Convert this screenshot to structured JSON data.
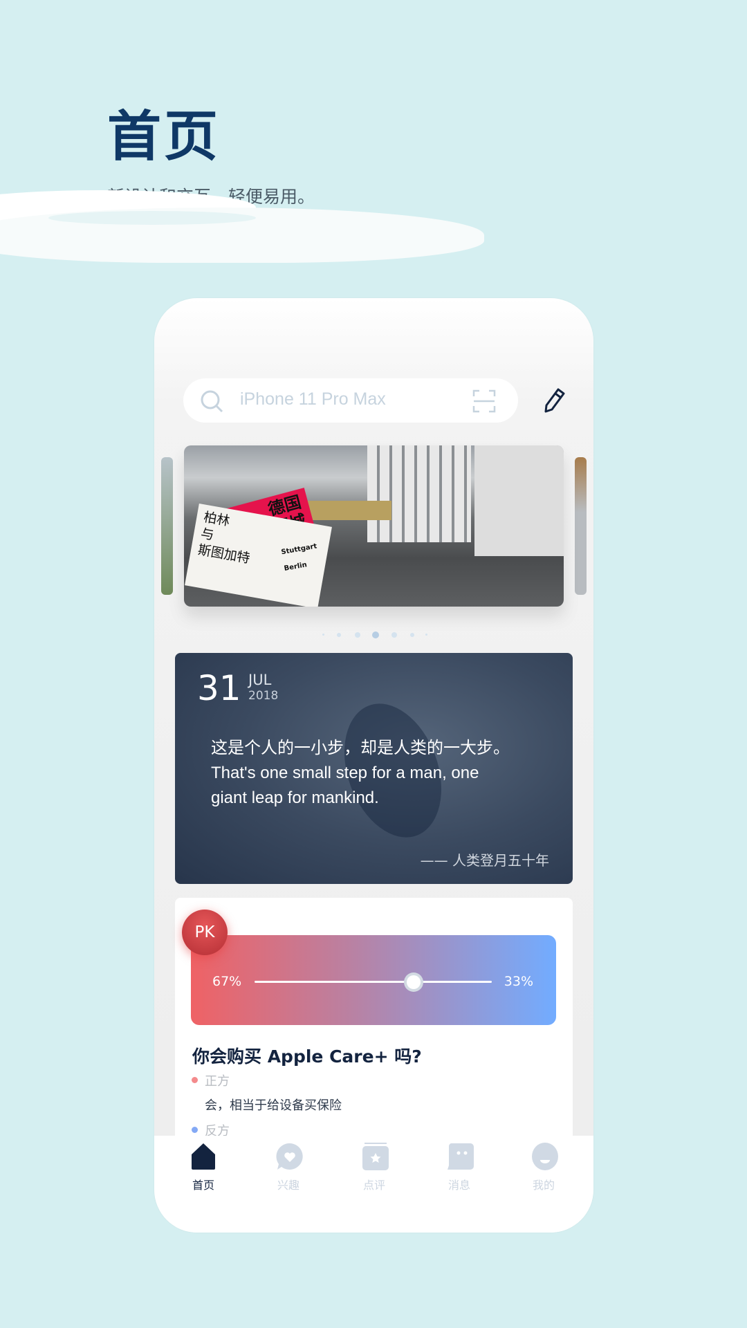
{
  "header": {
    "title": "首页",
    "subtitle": "新设计和交互，轻便易用。"
  },
  "search": {
    "placeholder": "iPhone 11 Pro Max"
  },
  "banner": {
    "card_red_text": "德国\n西城",
    "card_white_text_1": "柏林",
    "card_white_text_2": "与",
    "card_white_text_3": "斯图加特",
    "card_small_text": "Stuttgart\nBerlin",
    "active_index": 3,
    "dot_count": 7
  },
  "daily": {
    "day": "31",
    "month": "JUL",
    "year": "2018",
    "quote_cn": "这是个人的一小步，却是人类的一大步。",
    "quote_en_1": "That's one small step for a man, one",
    "quote_en_2": "giant leap for mankind.",
    "source": "—— 人类登月五十年"
  },
  "pk": {
    "badge": "PK",
    "left_percent": "67%",
    "right_percent": "33%",
    "slider_value": 0.67,
    "question": "你会购买 Apple Care+ 吗?",
    "pro_label": "正方",
    "pro_text": "会，相当于给设备买保险",
    "con_label": "反方",
    "colors": {
      "pro": "#ef6265",
      "con": "#72acff"
    }
  },
  "tabs": [
    {
      "label": "首页",
      "icon": "home-icon",
      "active": true
    },
    {
      "label": "兴趣",
      "icon": "heart-bubble-icon"
    },
    {
      "label": "点评",
      "icon": "star-card-icon"
    },
    {
      "label": "消息",
      "icon": "message-icon"
    },
    {
      "label": "我的",
      "icon": "profile-icon"
    }
  ],
  "colors": {
    "background": "#d5eff1",
    "title": "#0f3866",
    "active_tab": "#13233f",
    "inactive_tab": "#ccd5e0"
  }
}
